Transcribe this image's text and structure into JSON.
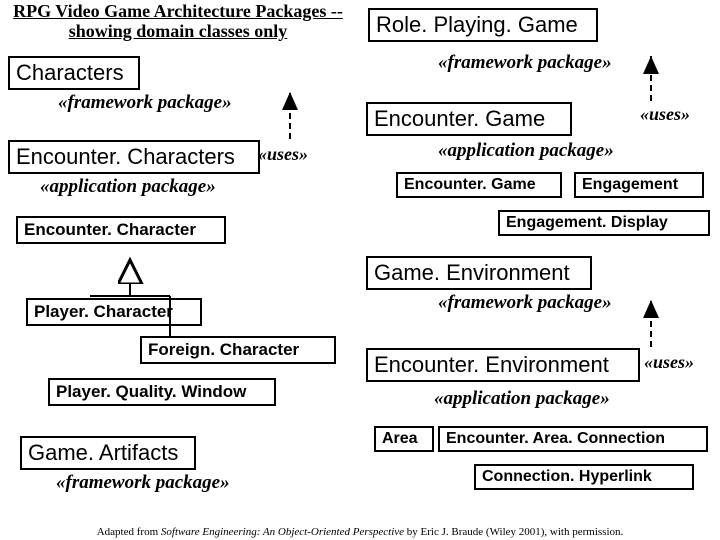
{
  "title_line1": "RPG Video Game Architecture Packages --",
  "title_line2": "showing domain classes only",
  "labels": {
    "framework": "«framework package»",
    "application": "«application package»",
    "uses": "«uses»"
  },
  "packages": {
    "characters": "Characters",
    "encounter_characters": "Encounter. Characters",
    "game_artifacts": "Game. Artifacts",
    "role_playing_game": "Role. Playing. Game",
    "encounter_game_pkg": "Encounter. Game",
    "game_environment": "Game. Environment",
    "encounter_environment": "Encounter. Environment"
  },
  "classes": {
    "encounter_character": "Encounter. Character",
    "player_character": "Player. Character",
    "foreign_character": "Foreign. Character",
    "player_quality_window": "Player. Quality. Window",
    "encounter_game": "Encounter. Game",
    "engagement": "Engagement",
    "engagement_display": "Engagement. Display",
    "area": "Area",
    "encounter_area_connection": "Encounter. Area. Connection",
    "connection_hyperlink": "Connection. Hyperlink"
  },
  "citation": "Adapted from Software Engineering: An Object-Oriented Perspective by Eric J. Braude (Wiley 2001), with permission."
}
